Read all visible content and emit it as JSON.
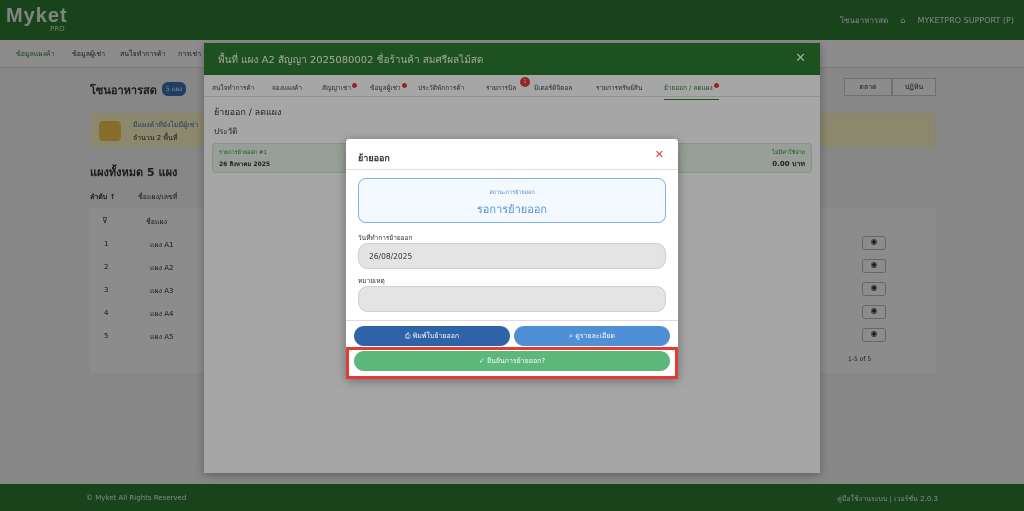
{
  "app": {
    "logo": "Myket",
    "logo_sub": "PRO",
    "nav_item": "โซนอาหารสด",
    "support": "MYKETPRO SUPPORT (P)"
  },
  "subnav": [
    "ข้อมูลแผงค้า",
    "ข้อมูลผู้เช่า",
    "สนใจทำการค้า",
    "การเช่า"
  ],
  "page": {
    "title": "โซนอาหารสด",
    "badge": "5 แผง",
    "alert_line1": "มีแผงค้าที่ยังไม่มีผู้เช่า",
    "alert_line2": "จำนวน 2 พื้นที่",
    "section_title": "แผงทั้งหมด 5 แผง",
    "sort_label": "ลำดับ ↑",
    "sort_name": "ชื่อแผง/เลขที่",
    "col_name": "ชื่อแผง",
    "rows": [
      {
        "no": "1",
        "name": "แผง A1"
      },
      {
        "no": "2",
        "name": "แผง A2"
      },
      {
        "no": "3",
        "name": "แผง A3"
      },
      {
        "no": "4",
        "name": "แผง A4"
      },
      {
        "no": "5",
        "name": "แผง A5"
      }
    ],
    "tabs_right": [
      "ตลาด",
      "ตลาด",
      "ปฏิทิน"
    ],
    "pager": "1-5 of 5"
  },
  "footer": {
    "left": "© Myket All Rights Reserved",
    "right": "คู่มือใช้งานระบบ | เวอร์ชั่น 2.0.3"
  },
  "modal": {
    "title": "พื้นที่ แผง A2 สัญญา 2025080002 ชื่อร้านค้า สมศรีผลไม้สด",
    "tabs": [
      "สนใจทำการค้า",
      "จองแผงค้า",
      "สัญญาเช่า",
      "ข้อมูลผู้เช่า",
      "ประวัติพักการค้า",
      "รายการบิล",
      "มิเตอร์ดิจิตอล",
      "รายการทรัพย์สิน",
      "ย้ายออก / ลดแผง"
    ],
    "bill_badge": "1",
    "section": "ย้ายออก / ลดแผง",
    "history": "ประวัติ",
    "record_label": "รายการย้ายออก #1",
    "record_date": "26 สิงหาคม 2025",
    "record_right_label": "ไม่มีค่าใช้จ่าย",
    "record_amount": "0.00 บาท"
  },
  "dialog": {
    "title": "ย้ายออก",
    "status_label": "สถานะการย้ายออก",
    "status_value": "รอการย้ายออก",
    "date_label": "วันที่ทำการย้ายออก",
    "date_value": "26/08/2025",
    "note_label": "หมายเหตุ",
    "note_value": "",
    "print_btn": "พิมพ์ใบย้ายออก",
    "detail_btn": "ดูรายละเอียด",
    "confirm_btn": "ยืนยันการย้ายออก?"
  },
  "colors": {
    "primary": "#2e7d32",
    "blue": "#2f63a8",
    "lightblue": "#4f8fd6",
    "green_btn": "#5cb87a",
    "highlight": "#e53935"
  }
}
